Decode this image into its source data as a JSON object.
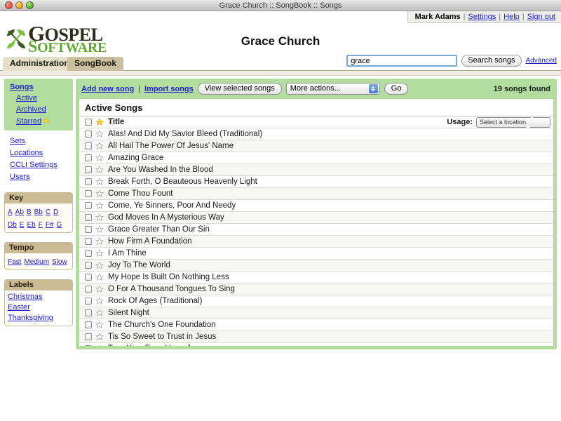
{
  "window": {
    "title": "Grace Church :: SongBook :: Songs",
    "controls": [
      "close",
      "minimize",
      "maximize"
    ]
  },
  "user_bar": {
    "user_name": "Mark Adams",
    "separator": "|",
    "links": [
      "Settings",
      "Help",
      "Sign out"
    ]
  },
  "logo": {
    "line1": "GOSPEL",
    "line1_cap": "G",
    "line1_rest": "OSPEL",
    "line2_cap": "S",
    "line2_rest": "OFTWARE"
  },
  "header": {
    "church_title": "Grace Church"
  },
  "tabs": [
    {
      "label": "Administration",
      "active": false
    },
    {
      "label": "SongBook",
      "active": true
    }
  ],
  "search": {
    "value": "grace",
    "placeholder": "",
    "button_label": "Search songs",
    "advanced_label": "Advanced"
  },
  "sidebar": {
    "songs_group": {
      "head": "Songs",
      "items": [
        {
          "label": "Active",
          "star": false
        },
        {
          "label": "Archived",
          "star": false
        },
        {
          "label": "Starred",
          "star": true
        }
      ]
    },
    "links": [
      "Sets",
      "Locations",
      "CCLI Settings",
      "Users"
    ],
    "panels": [
      {
        "title": "Key",
        "layout": "chips",
        "items": [
          "A",
          "Ab",
          "B",
          "Bb",
          "C",
          "D",
          "Db",
          "E",
          "Eb",
          "F",
          "F#",
          "G"
        ]
      },
      {
        "title": "Tempo",
        "layout": "chips",
        "items": [
          "Fast",
          "Medium",
          "Slow"
        ]
      },
      {
        "title": "Labels",
        "layout": "blocks",
        "items": [
          "Christmas",
          "Easter",
          "Thanksgiving"
        ]
      }
    ]
  },
  "toolbar": {
    "add_new_song": "Add new song",
    "pipe": "|",
    "import_songs": "Import songs",
    "view_selected_label": "View selected songs",
    "more_actions_value": "More actions...",
    "go_label": "Go",
    "results_count": "19 songs found"
  },
  "list": {
    "title": "Active Songs",
    "column_header": "Title",
    "usage_label": "Usage:",
    "usage_value": "Select a location",
    "songs": [
      "Alas! And Did My Savior Bleed (Traditional)",
      "All Hail The Power Of Jesus' Name",
      "Amazing Grace",
      "Are You Washed In the Blood",
      "Break Forth, O Beauteous Heavenly Light",
      "Come Thou Fount",
      "Come, Ye Sinners, Poor And Needy",
      "God Moves In A Mysterious Way",
      "Grace Greater Than Our Sin",
      "How Firm A Foundation",
      "I Am Thine",
      "Joy To The World",
      "My Hope Is Built On Nothing Less",
      "O For A Thousand Tongues To Sing",
      "Rock Of Ages (Traditional)",
      "Silent Night",
      "The Church's One Foundation",
      "Tis So Sweet to Trust in Jesus",
      "Turn Your Eyes Upon Jesus"
    ]
  },
  "colors": {
    "panel_green": "#b2dd9e",
    "tan_header": "#cbbb94",
    "tab_active": "#cbc09d",
    "tab_inactive": "#e6dfc8",
    "link_blue": "#2222cc",
    "logo_green": "#5eaa2e",
    "logo_dark": "#2e2a1a",
    "star_gold": "#ffcc33"
  }
}
